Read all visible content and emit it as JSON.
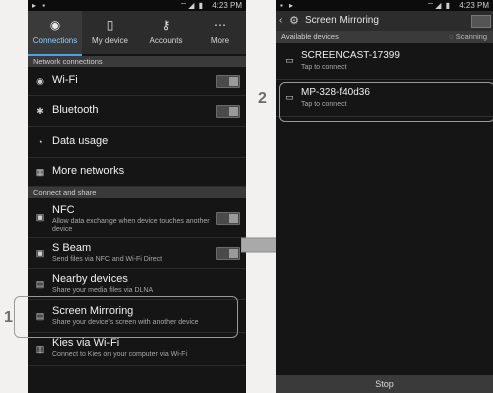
{
  "callouts": {
    "one": "1",
    "two": "2"
  },
  "left_screen": {
    "status_time": "4:23 PM",
    "tabs": [
      {
        "label": "Connections",
        "icon": "wifi-icon"
      },
      {
        "label": "My device",
        "icon": "device-icon"
      },
      {
        "label": "Accounts",
        "icon": "key-icon"
      },
      {
        "label": "More",
        "icon": "more-icon"
      }
    ],
    "sections": {
      "network": "Network connections",
      "connect_share": "Connect and share"
    },
    "network_rows": {
      "wifi": {
        "title": "Wi-Fi"
      },
      "bluetooth": {
        "title": "Bluetooth"
      },
      "data_usage": {
        "title": "Data usage"
      },
      "more_networks": {
        "title": "More networks"
      }
    },
    "share_rows": {
      "nfc": {
        "title": "NFC",
        "subtitle": "Allow data exchange when device touches another device"
      },
      "sbeam": {
        "title": "S Beam",
        "subtitle": "Send files via NFC and Wi-Fi Direct"
      },
      "nearby": {
        "title": "Nearby devices",
        "subtitle": "Share your media files via DLNA"
      },
      "mirroring": {
        "title": "Screen Mirroring",
        "subtitle": "Share your device's screen with another device"
      },
      "kies": {
        "title": "Kies via Wi-Fi",
        "subtitle": "Connect to Kies on your computer via Wi-Fi"
      }
    }
  },
  "right_screen": {
    "status_time": "4:23 PM",
    "title": "Screen Mirroring",
    "available_label": "Available devices",
    "scanning_label": "Scanning",
    "devices": [
      {
        "name": "SCREENCAST-17399",
        "status": "Tap to connect"
      },
      {
        "name": "MP-328-f40d36",
        "status": "Tap to connect"
      }
    ],
    "stop_label": "Stop"
  },
  "colors": {
    "accent": "#4aa3df",
    "screen_bg": "#151515",
    "bar_bg": "#2c2c2c"
  }
}
